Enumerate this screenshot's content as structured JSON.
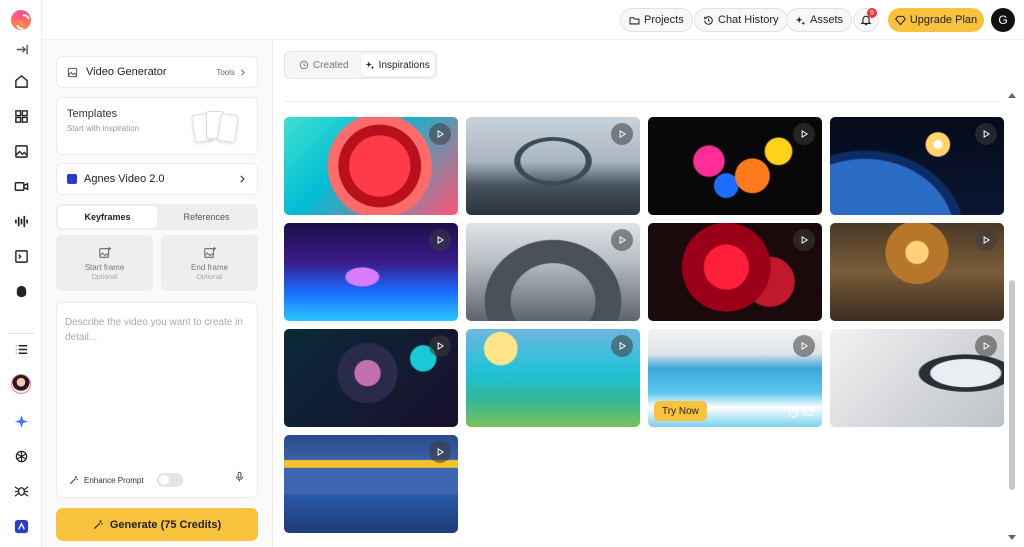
{
  "topbar": {
    "projects": "Projects",
    "chat_history": "Chat History",
    "assets": "Assets",
    "notification_count": "9",
    "upgrade": "Upgrade Plan",
    "user_initial": "G"
  },
  "panel": {
    "video_generator": "Video Generator",
    "tools": "Tools",
    "templates_title": "Templates",
    "templates_sub": "Start with inspiration",
    "model": "Agnes Video 2.0",
    "tab_keyframes": "Keyframes",
    "tab_references": "References",
    "start_frame": "Start frame",
    "end_frame": "End frame",
    "optional": "Optional",
    "prompt_placeholder": "Describe the video you want to create in detail...",
    "enhance_prompt": "Enhance Prompt",
    "enhance_enabled": false,
    "generate": "Generate (75 Credits)"
  },
  "main": {
    "tab_created": "Created",
    "tab_inspirations": "Inspirations",
    "active_tab": "Inspirations",
    "try_now": "Try Now",
    "likes": "62"
  },
  "icons": {
    "rail": [
      "collapse-sidebar-icon",
      "home-icon",
      "grid-icon",
      "image-icon",
      "video-icon",
      "audio-wave-icon",
      "terminal-icon",
      "mask-icon",
      "list-icon",
      "sparkle-icon",
      "openai-icon",
      "spider-icon",
      "app-icon"
    ]
  },
  "colors": {
    "accent": "#f9c23c",
    "badge": "#e53935"
  }
}
